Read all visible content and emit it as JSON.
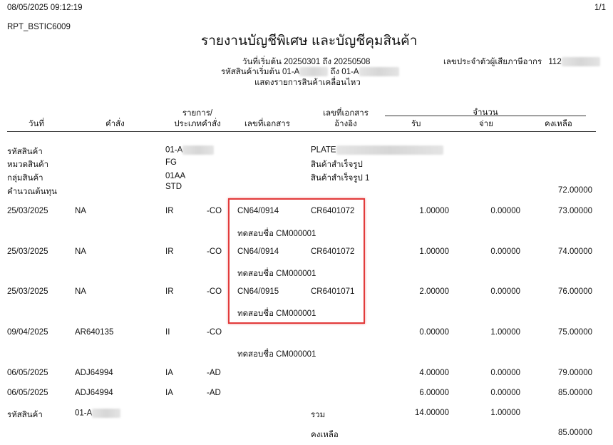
{
  "report": {
    "timestamp": "08/05/2025 09:12:19",
    "page": "1/1",
    "report_id": "RPT_BSTIC6009",
    "title": "รายงานบัญชีพิเศษ และบัญชีคุมสินค้า",
    "date_range": "วันที่เริ่มต้น 20250301 ถึง 20250508",
    "tax_id_label": "เลขประจำตัวผู้เสียภาษีอากร",
    "tax_id_visible": "112",
    "product_range_label": "รหัสสินค้าเริ่มต้น",
    "product_start_visible": "01-A",
    "product_to": "ถึง 01-A",
    "filter_note": "แสดงรายการสินค้าเคลื่อนไหว"
  },
  "columns": {
    "date": "วันที่",
    "order": "คำสั่ง",
    "type_line1": "รายการ/",
    "type_line2": "ประเภทคำสั่ง",
    "doc_no": "เลขที่เอกสาร",
    "ref_line1": "เลขที่เอกสาร",
    "ref_line2": "อ้างอิง",
    "qty_group": "จำนวน",
    "receive": "รับ",
    "issue": "จ่าย",
    "balance": "คงเหลือ"
  },
  "product_info": {
    "code_label": "รหัสสินค้า",
    "code_visible": "01-A",
    "name_visible": "PLATE",
    "category_label": "หมวดสินค้า",
    "category_code": "FG",
    "category_name": "สินค้าสำเร็จรูป",
    "group_label": "กลุ่มสินค้า",
    "group_code": "01AA",
    "group_name": "สินค้าสำเร็จรูป 1",
    "costing_label": "คำนวณต้นทุน",
    "costing_method": "STD",
    "opening_balance": "72.00000"
  },
  "rows": [
    {
      "date": "25/03/2025",
      "order": "NA",
      "type": "IR",
      "type2": "-CO",
      "doc": "CN64/0914",
      "ref": "CR6401072",
      "receive": "1.00000",
      "issue": "0.00000",
      "balance": "73.00000",
      "note": "ทดสอบชื่อ CM000001"
    },
    {
      "date": "25/03/2025",
      "order": "NA",
      "type": "IR",
      "type2": "-CO",
      "doc": "CN64/0914",
      "ref": "CR6401072",
      "receive": "1.00000",
      "issue": "0.00000",
      "balance": "74.00000",
      "note": "ทดสอบชื่อ CM000001"
    },
    {
      "date": "25/03/2025",
      "order": "NA",
      "type": "IR",
      "type2": "-CO",
      "doc": "CN64/0915",
      "ref": "CR6401071",
      "receive": "2.00000",
      "issue": "0.00000",
      "balance": "76.00000",
      "note": "ทดสอบชื่อ CM000001"
    },
    {
      "date": "09/04/2025",
      "order": "AR640135",
      "type": "II",
      "type2": "-CO",
      "doc": "",
      "ref": "",
      "receive": "0.00000",
      "issue": "1.00000",
      "balance": "75.00000",
      "note": "ทดสอบชื่อ CM000001"
    },
    {
      "date": "06/05/2025",
      "order": "ADJ64994",
      "type": "IA",
      "type2": "-AD",
      "doc": "",
      "ref": "",
      "receive": "4.00000",
      "issue": "0.00000",
      "balance": "79.00000",
      "note": ""
    },
    {
      "date": "06/05/2025",
      "order": "ADJ64994",
      "type": "IA",
      "type2": "-AD",
      "doc": "",
      "ref": "",
      "receive": "6.00000",
      "issue": "0.00000",
      "balance": "85.00000",
      "note": ""
    }
  ],
  "summary": {
    "code_label": "รหัสสินค้า",
    "code_visible": "01-A",
    "total_label": "รวม",
    "total_receive": "14.00000",
    "total_issue": "1.00000",
    "balance_label": "คงเหลือ",
    "final_balance": "85.00000"
  },
  "colors": {
    "highlight_border": "#e23b3b",
    "text": "#111111"
  }
}
